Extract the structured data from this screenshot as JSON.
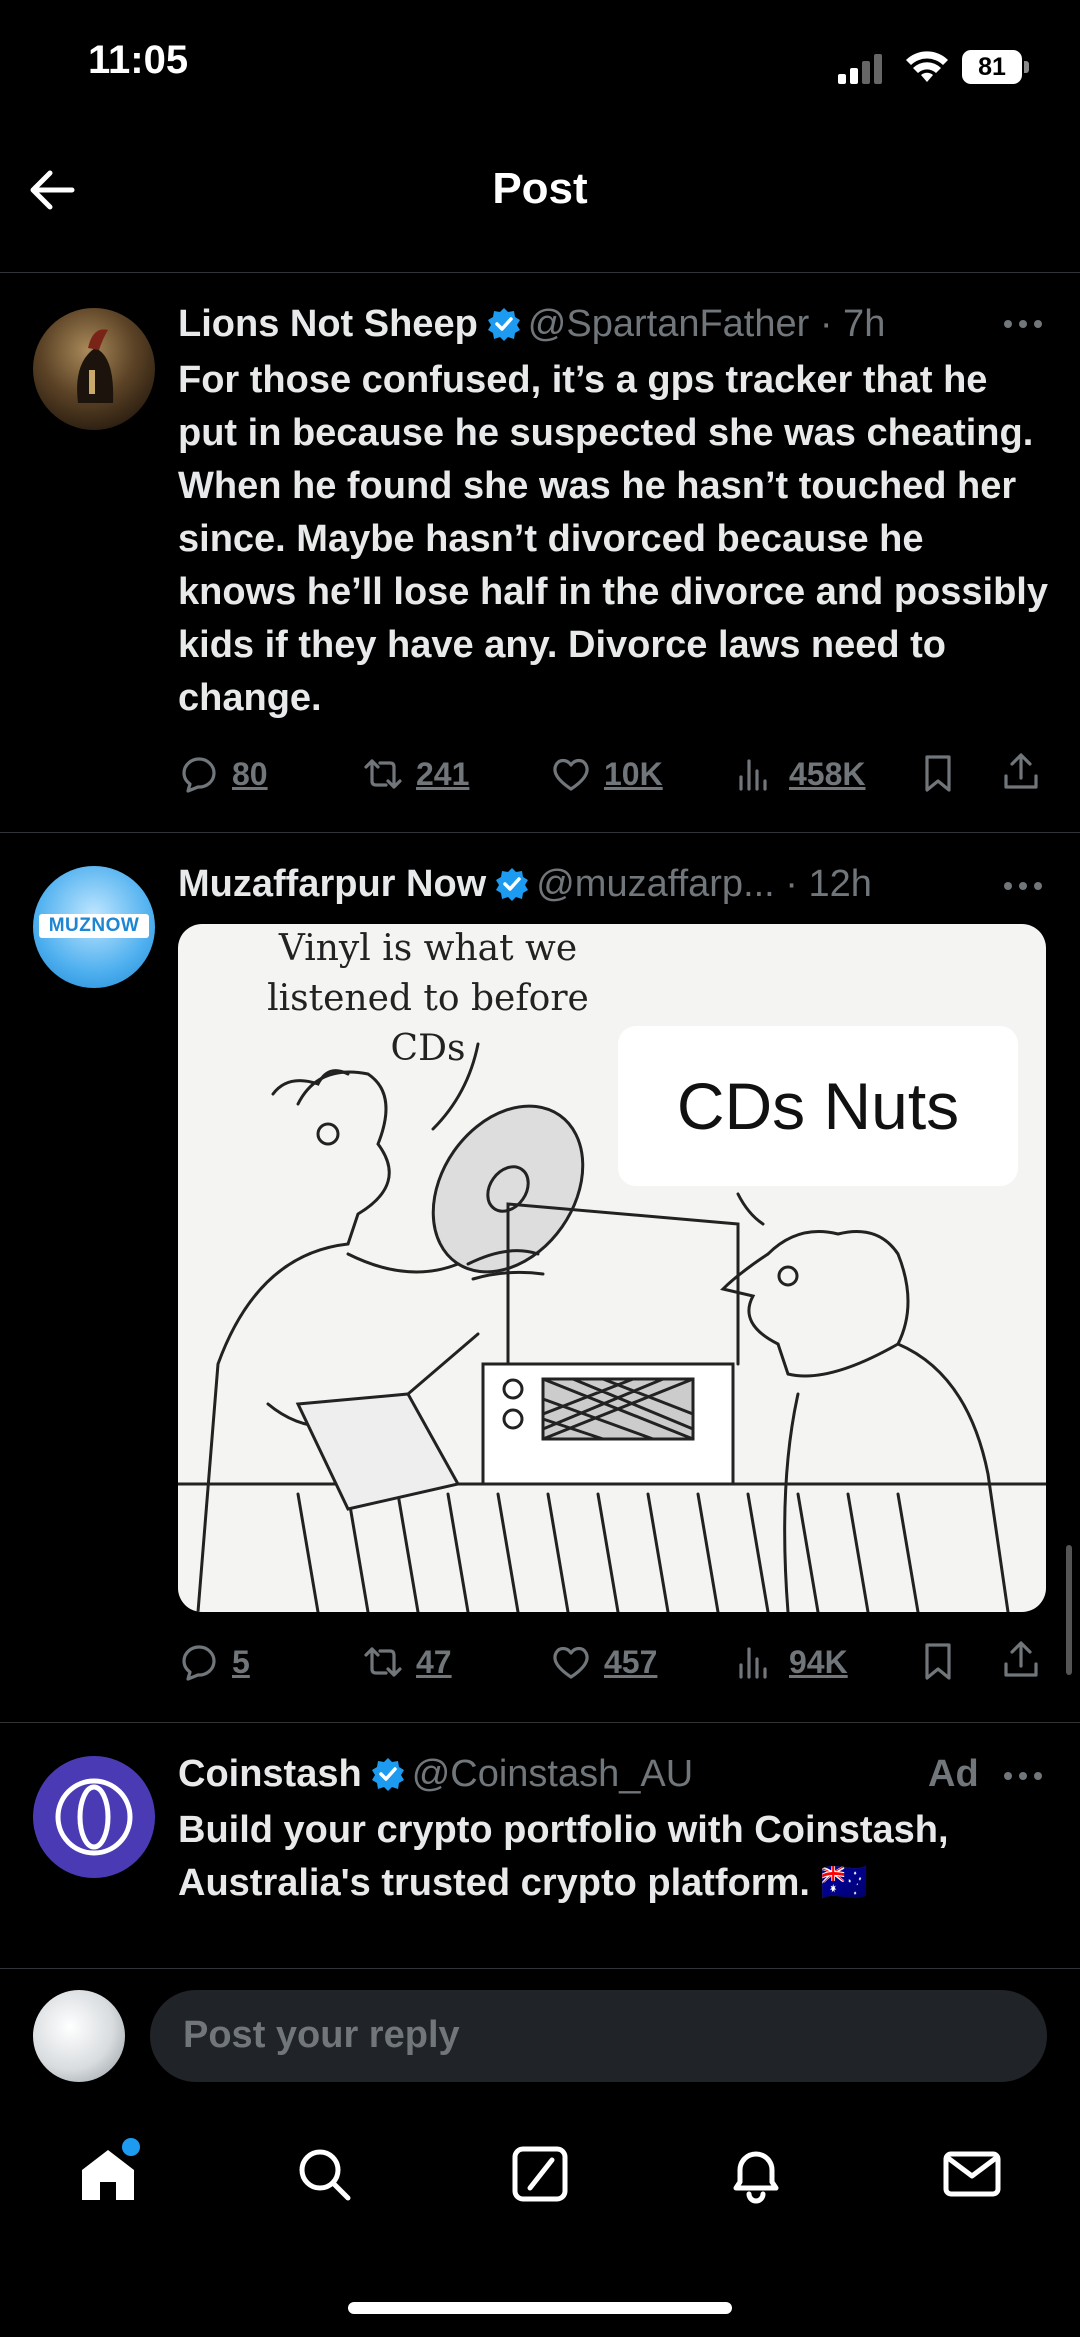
{
  "status_bar": {
    "time": "11:05",
    "battery": "81"
  },
  "header": {
    "title": "Post"
  },
  "posts": [
    {
      "name": "Lions Not Sheep",
      "handle": "@SpartanFather · 7h",
      "text": "For those confused, it’s a gps tracker that he put in because he suspected she was cheating. When he found she was he hasn’t touched her since. Maybe hasn’t divorced because he knows he’ll lose half in the divorce and possibly kids if they have any. Divorce laws need to change.",
      "replies": "80",
      "reposts": "241",
      "likes": "10K",
      "views": "458K"
    },
    {
      "name": "Muzaffarpur Now",
      "handle": "@muzaffarp... · 12h",
      "avatar_text": "MUZNOW",
      "cartoon_caption": "Vinyl is what we listened to before CDs",
      "cartoon_overlay": "CDs Nuts",
      "replies": "5",
      "reposts": "47",
      "likes": "457",
      "views": "94K"
    },
    {
      "name": "Coinstash",
      "handle": "@Coinstash_AU",
      "ad_label": "Ad",
      "text": "Build your crypto portfolio with Coinstash, Australia's trusted crypto platform. 🇦🇺"
    }
  ],
  "reply": {
    "placeholder": "Post your reply"
  },
  "icons": {
    "back": "arrow-left-icon",
    "verified": "verified-badge-icon",
    "reply": "comment-icon",
    "repost": "repost-icon",
    "like": "heart-icon",
    "views": "views-icon",
    "bookmark": "bookmark-icon",
    "share": "share-icon",
    "tabs": [
      "home-icon",
      "search-icon",
      "compose-icon",
      "bell-icon",
      "mail-icon"
    ]
  },
  "colors": {
    "background": "#000000",
    "accent": "#1d9bf0",
    "muted": "#71767b",
    "text": "#e7e9ea"
  }
}
